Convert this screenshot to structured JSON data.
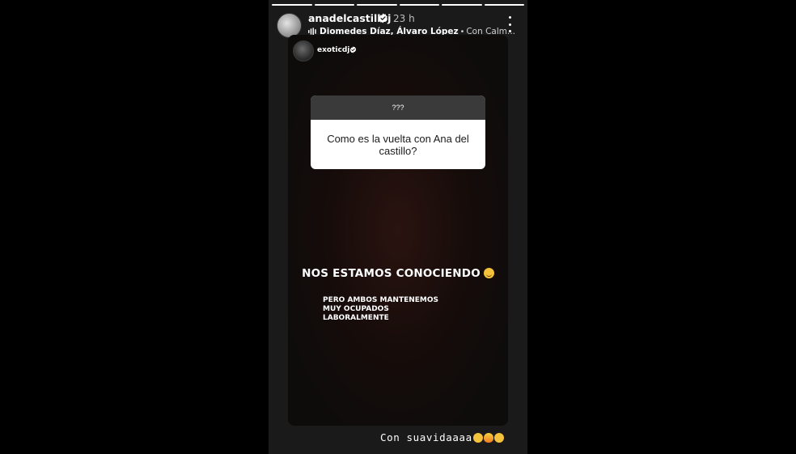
{
  "story": {
    "progress_segments": 6,
    "progress_done": 6,
    "header": {
      "username": "anadelcastilloj",
      "time": "23 h",
      "music_artists": "Diomedes Díaz, Álvaro López",
      "music_separator": "•",
      "music_song": "Con Calm..."
    },
    "shared_post": {
      "username": "exoticdj",
      "question_header": "???",
      "question_text": "Como es la vuelta con Ana del castillo?",
      "headline": "NOS ESTAMOS CONOCIENDO",
      "subtext_lines": [
        "PERO AMBOS MANTENEMOS",
        "MUY OCUPADOS",
        "LABORALMENTE"
      ]
    },
    "caption": "Con suavidaaaa",
    "colors": {
      "story_bg": "#1a1a1a",
      "card_bg": "#0e0c0b",
      "question_header_bg": "#3a3a3a",
      "verified_blue": "#ffffff"
    },
    "icons": [
      "verified-badge-icon",
      "more-options-icon",
      "music-wave-icon"
    ]
  }
}
